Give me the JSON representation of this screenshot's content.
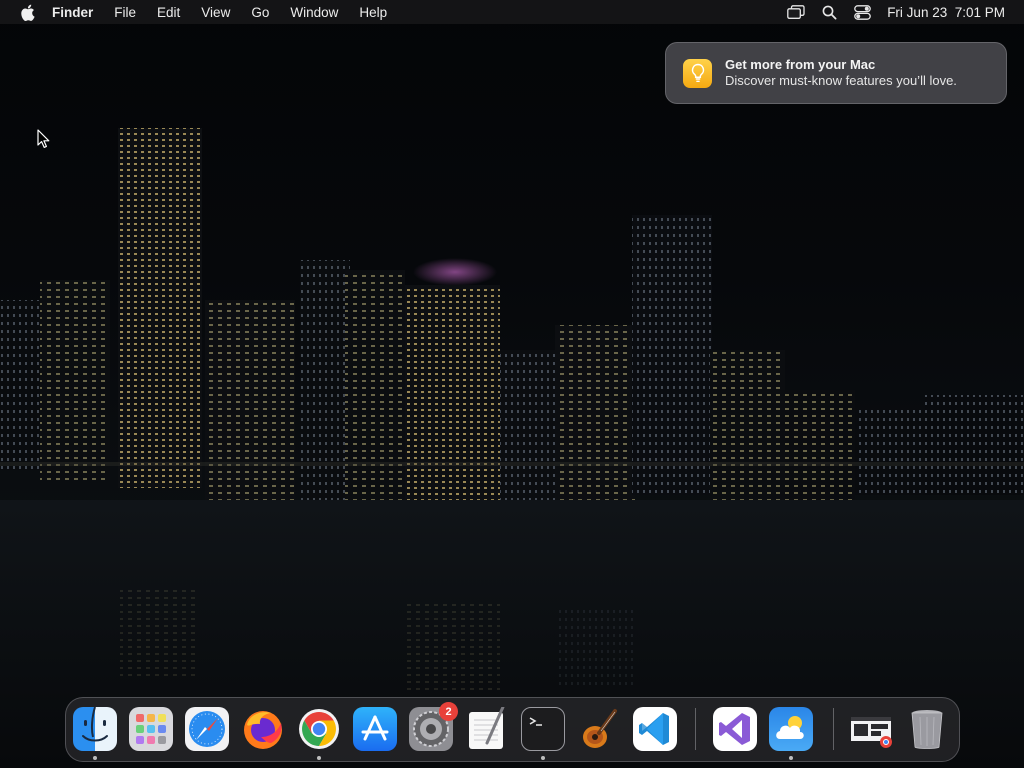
{
  "menubar": {
    "app_name": "Finder",
    "menus": [
      "File",
      "Edit",
      "View",
      "Go",
      "Window",
      "Help"
    ],
    "status_icons": [
      "screen-mirroring-icon",
      "spotlight-search-icon",
      "control-center-icon"
    ],
    "clock": "Fri Jun 23  7:01 PM"
  },
  "notification": {
    "icon": "lightbulb-icon",
    "title": "Get more from your Mac",
    "body": "Discover must-know features you’ll love."
  },
  "dock": {
    "apps": [
      {
        "name": "Finder",
        "icon": "finder-icon",
        "running": true
      },
      {
        "name": "Launchpad",
        "icon": "launchpad-icon",
        "running": false
      },
      {
        "name": "Safari",
        "icon": "safari-icon",
        "running": false
      },
      {
        "name": "Firefox",
        "icon": "firefox-icon",
        "running": false
      },
      {
        "name": "Google Chrome",
        "icon": "chrome-icon",
        "running": true
      },
      {
        "name": "App Store",
        "icon": "app-store-icon",
        "running": false
      },
      {
        "name": "System Settings",
        "icon": "system-settings-icon",
        "running": false,
        "badge": "2"
      },
      {
        "name": "TextEdit",
        "icon": "textedit-icon",
        "running": false
      },
      {
        "name": "Terminal",
        "icon": "terminal-icon",
        "running": true
      },
      {
        "name": "GarageBand",
        "icon": "garageband-icon",
        "running": false
      },
      {
        "name": "Visual Studio Code",
        "icon": "vscode-icon",
        "running": false
      },
      {
        "name": "Visual Studio",
        "icon": "visual-studio-icon",
        "running": false
      },
      {
        "name": "Weather",
        "icon": "weather-icon",
        "running": true
      },
      {
        "name": "Chrome Window",
        "icon": "chrome-window-icon",
        "running": false
      },
      {
        "name": "Trash",
        "icon": "trash-icon",
        "running": false
      }
    ]
  },
  "colors": {
    "menubar_bg": "#161618",
    "notification_bg": "#4a4a4e",
    "badge_red": "#e8413a",
    "lightbulb_yellow": "#f5b819"
  }
}
